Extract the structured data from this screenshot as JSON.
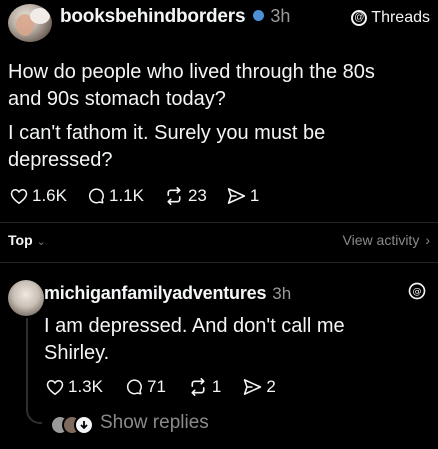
{
  "post": {
    "username": "booksbehindborders",
    "time": "3h",
    "app_label": "Threads",
    "lines": [
      "How do people who lived through the 80s",
      "and 90s stomach today?",
      "I can't fathom it. Surely you must be",
      "depressed?"
    ],
    "likes": "1.6K",
    "comments": "1.1K",
    "reposts": "23",
    "shares": "1"
  },
  "sort_bar": {
    "sort_label": "Top",
    "view_activity_label": "View activity"
  },
  "reply": {
    "username": "michiganfamilyadventures",
    "time": "3h",
    "lines": [
      "I am depressed. And don't call me",
      "Shirley."
    ],
    "likes": "1.3K",
    "comments": "71",
    "reposts": "1",
    "shares": "2",
    "show_replies_label": "Show replies"
  },
  "colors": {
    "background": "#000000",
    "text": "#f3f5f7",
    "muted": "#8a8a8a",
    "verified": "#4f8fd6"
  }
}
